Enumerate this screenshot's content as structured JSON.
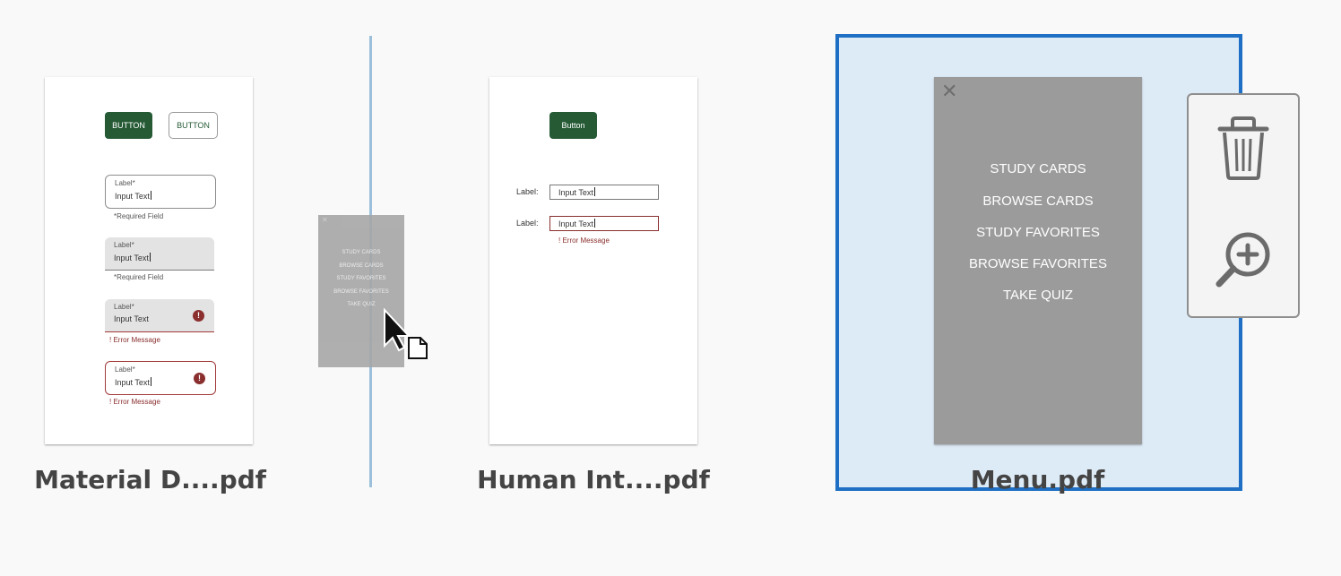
{
  "files": [
    {
      "caption": "Material D....pdf",
      "page": {
        "buttons": {
          "filled": "BUTTON",
          "outlined": "BUTTON"
        },
        "fields": [
          {
            "label": "Label*",
            "value": "Input Text",
            "helper": "*Required Field"
          },
          {
            "label": "Label*",
            "value": "Input Text",
            "helper": "*Required Field"
          },
          {
            "label": "Label*",
            "value": "Input Text",
            "helper": "! Error Message",
            "error_glyph": "!"
          },
          {
            "label": "Label*",
            "value": "Input Text",
            "helper": "! Error Message",
            "error_glyph": "!"
          }
        ]
      }
    },
    {
      "caption": "Human Int....pdf",
      "page": {
        "button": "Button",
        "fields": [
          {
            "label": "Label:",
            "value": "Input Text"
          },
          {
            "label": "Label:",
            "value": "Input Text",
            "error": "! Error Message"
          }
        ]
      }
    },
    {
      "caption": "Menu.pdf",
      "selected": true,
      "page": {
        "close_glyph": "✕",
        "items": [
          "STUDY CARDS",
          "BROWSE CARDS",
          "STUDY FAVORITES",
          "BROWSE FAVORITES",
          "TAKE QUIZ"
        ]
      }
    }
  ],
  "drag_ghost": {
    "close_glyph": "✕",
    "items": [
      "STUDY CARDS",
      "BROWSE CARDS",
      "STUDY FAVORITES",
      "BROWSE FAVORITES",
      "TAKE QUIZ"
    ]
  },
  "actions": [
    {
      "name": "delete",
      "icon": "trash-icon"
    },
    {
      "name": "zoom",
      "icon": "zoom-in-icon"
    }
  ],
  "colors": {
    "selection_border": "#1f6fc4",
    "selection_fill": "#ddebf7",
    "insert_line": "#9cc0dc",
    "button_green": "#255a35",
    "error_red": "#8a2e2e"
  }
}
